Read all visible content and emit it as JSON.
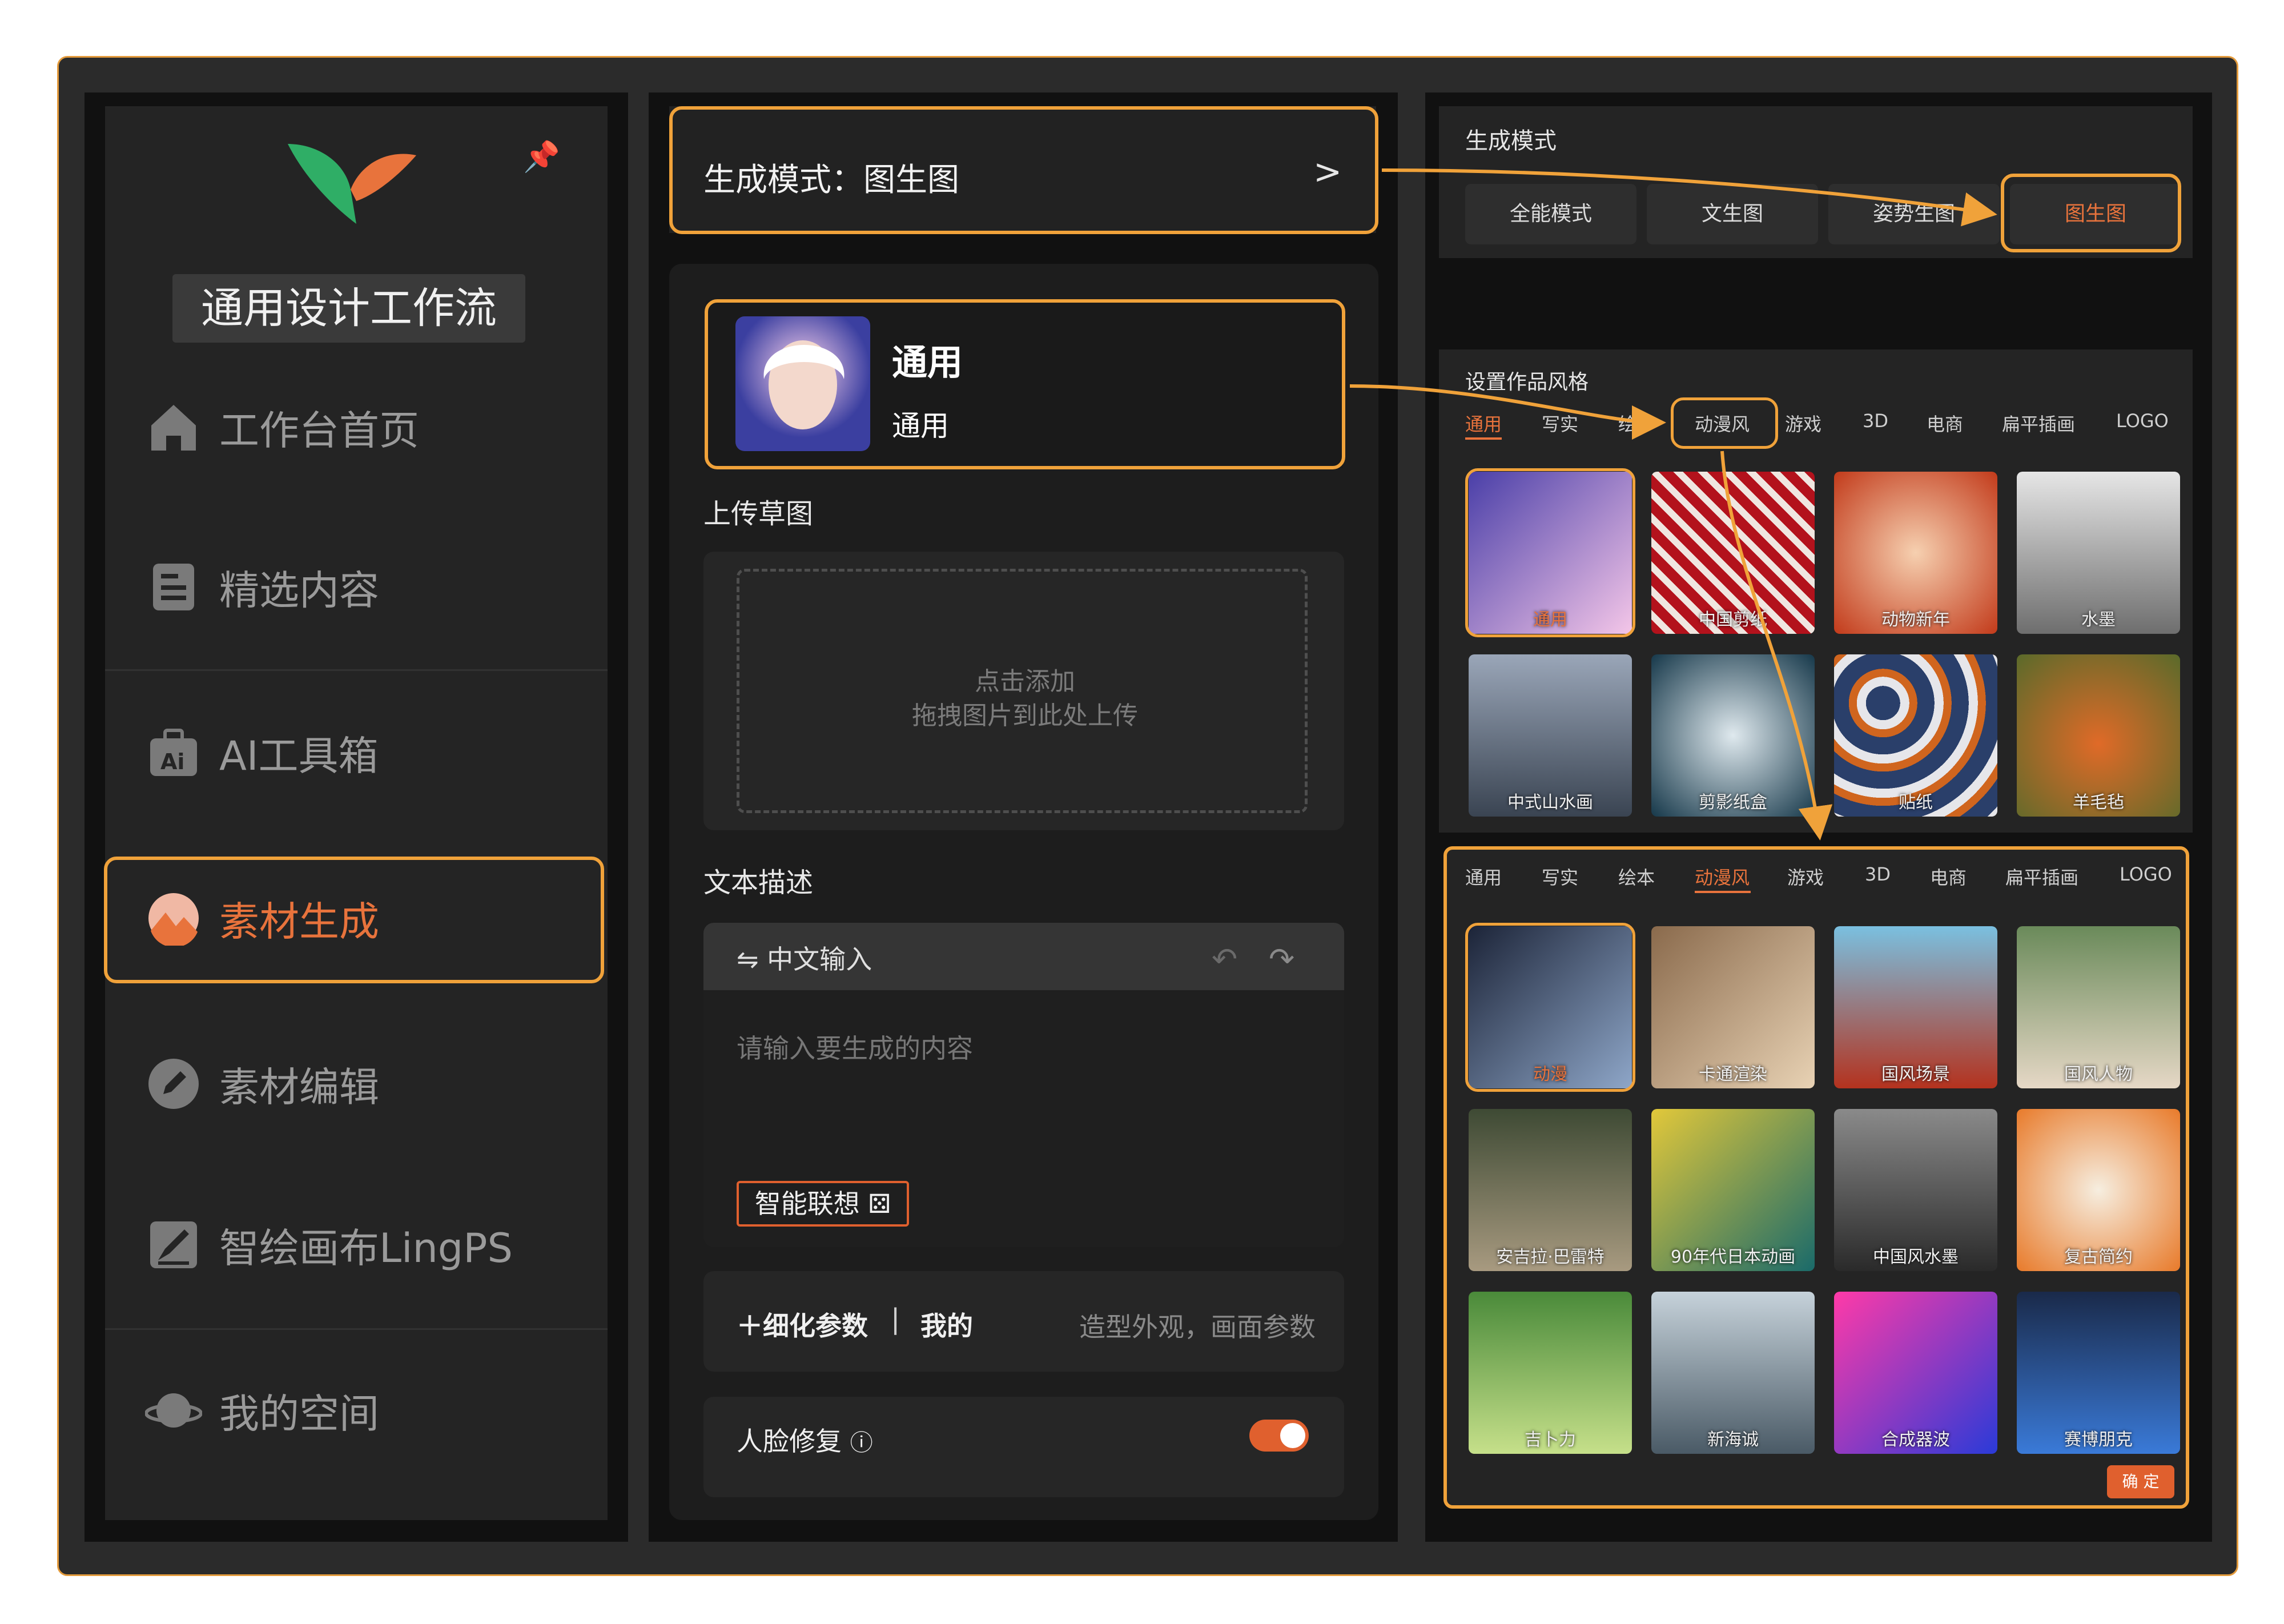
{
  "sidebar": {
    "workflow_title": "通用设计工作流",
    "items": [
      {
        "label": "工作台首页",
        "icon": "home-icon"
      },
      {
        "label": "精选内容",
        "icon": "document-icon"
      },
      {
        "label": "AI工具箱",
        "icon": "ai-toolbox-icon"
      },
      {
        "label": "素材生成",
        "icon": "image-generate-icon",
        "active": true
      },
      {
        "label": "素材编辑",
        "icon": "edit-icon"
      },
      {
        "label": "智绘画布LingPS",
        "icon": "canvas-icon"
      },
      {
        "label": "我的空间",
        "icon": "planet-icon"
      }
    ]
  },
  "middle": {
    "mode_label": "生成模式：图生图",
    "style_name": "通用",
    "style_sub": "通用",
    "upload_title": "上传草图",
    "upload_hint1": "点击添加",
    "upload_hint2": "拖拽图片到此处上传",
    "text_title": "文本描述",
    "input_mode": "中文输入",
    "placeholder": "请输入要生成的内容",
    "smart_button": "智能联想",
    "param_add": "细化参数",
    "param_mine": "我的",
    "param_hint": "造型外观，画面参数",
    "face_fix": "人脸修复",
    "face_fix_enabled": true
  },
  "right_mode": {
    "title": "生成模式",
    "options": [
      "全能模式",
      "文生图",
      "姿势生图",
      "图生图"
    ],
    "selected": "图生图"
  },
  "right_style": {
    "title": "设置作品风格",
    "tabs": [
      "通用",
      "写实",
      "绘",
      "动漫风",
      "游戏",
      "3D",
      "电商",
      "扁平插画",
      "LOGO"
    ],
    "selected_tab": "通用",
    "items": [
      "通用",
      "中国剪纸",
      "动物新年",
      "水墨",
      "中式山水画",
      "剪影纸盒",
      "贴纸",
      "羊毛毡"
    ]
  },
  "anime_popup": {
    "tabs": [
      "通用",
      "写实",
      "绘本",
      "动漫风",
      "游戏",
      "3D",
      "电商",
      "扁平插画",
      "LOGO"
    ],
    "selected_tab": "动漫风",
    "items": [
      "动漫",
      "卡通渲染",
      "国风场景",
      "国风人物",
      "安吉拉·巴雷特",
      "90年代日本动画",
      "中国风水墨",
      "复古简约",
      "吉卜力",
      "新海诚",
      "合成器波",
      "赛博朋克"
    ],
    "confirm": "确 定"
  },
  "colors": {
    "accent": "#e8733c",
    "highlight": "#f0a23a",
    "bg": "#2b2b2b"
  }
}
